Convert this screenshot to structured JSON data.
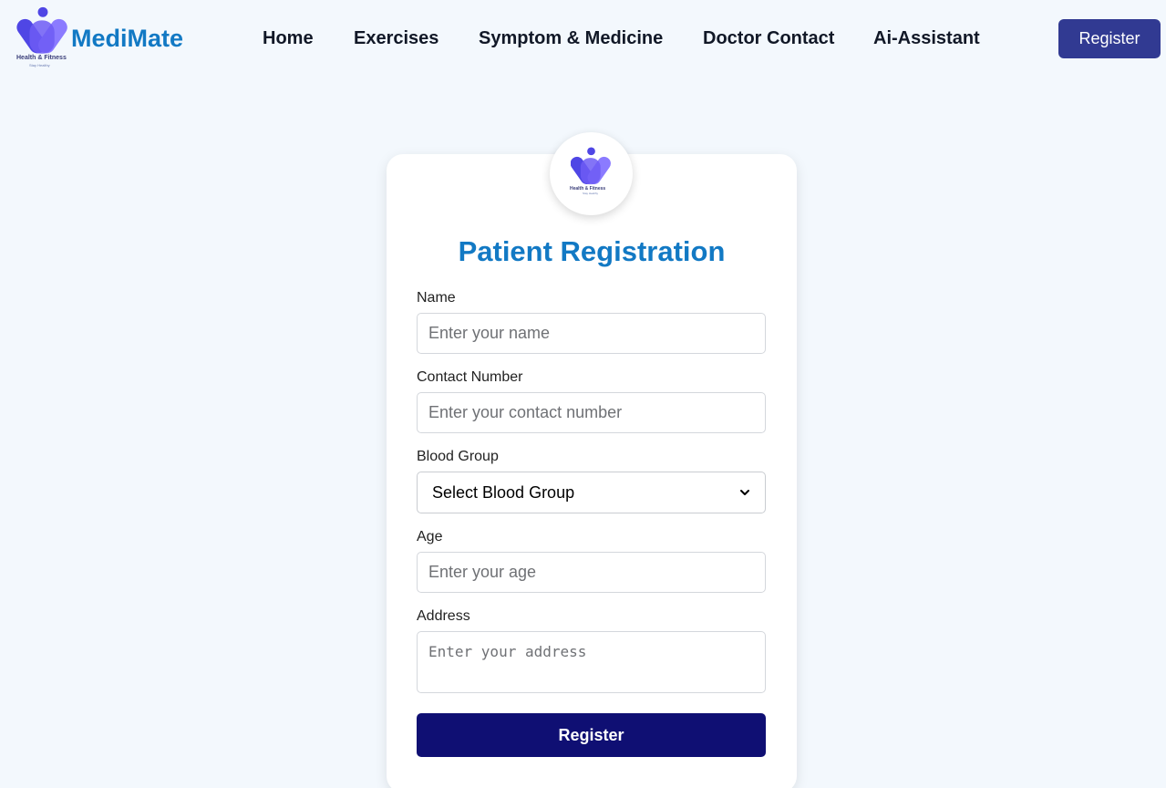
{
  "brand": {
    "name": "MediMate",
    "tagline": "Health & Fitness",
    "subtagline": "Stay Healthy"
  },
  "nav": {
    "links": [
      "Home",
      "Exercises",
      "Symptom & Medicine",
      "Doctor Contact",
      "Ai-Assistant"
    ],
    "register_label": "Register"
  },
  "form": {
    "title": "Patient Registration",
    "name_label": "Name",
    "name_placeholder": "Enter your name",
    "contact_label": "Contact Number",
    "contact_placeholder": "Enter your contact number",
    "blood_label": "Blood Group",
    "blood_selected": "Select Blood Group",
    "age_label": "Age",
    "age_placeholder": "Enter your age",
    "address_label": "Address",
    "address_placeholder": "Enter your address",
    "submit_label": "Register"
  },
  "colors": {
    "brand_blue": "#1279c4",
    "nav_button": "#313a92",
    "submit_button": "#0f0f73",
    "logo_purple": "#7b61ff",
    "logo_indigo": "#4f46e5"
  }
}
